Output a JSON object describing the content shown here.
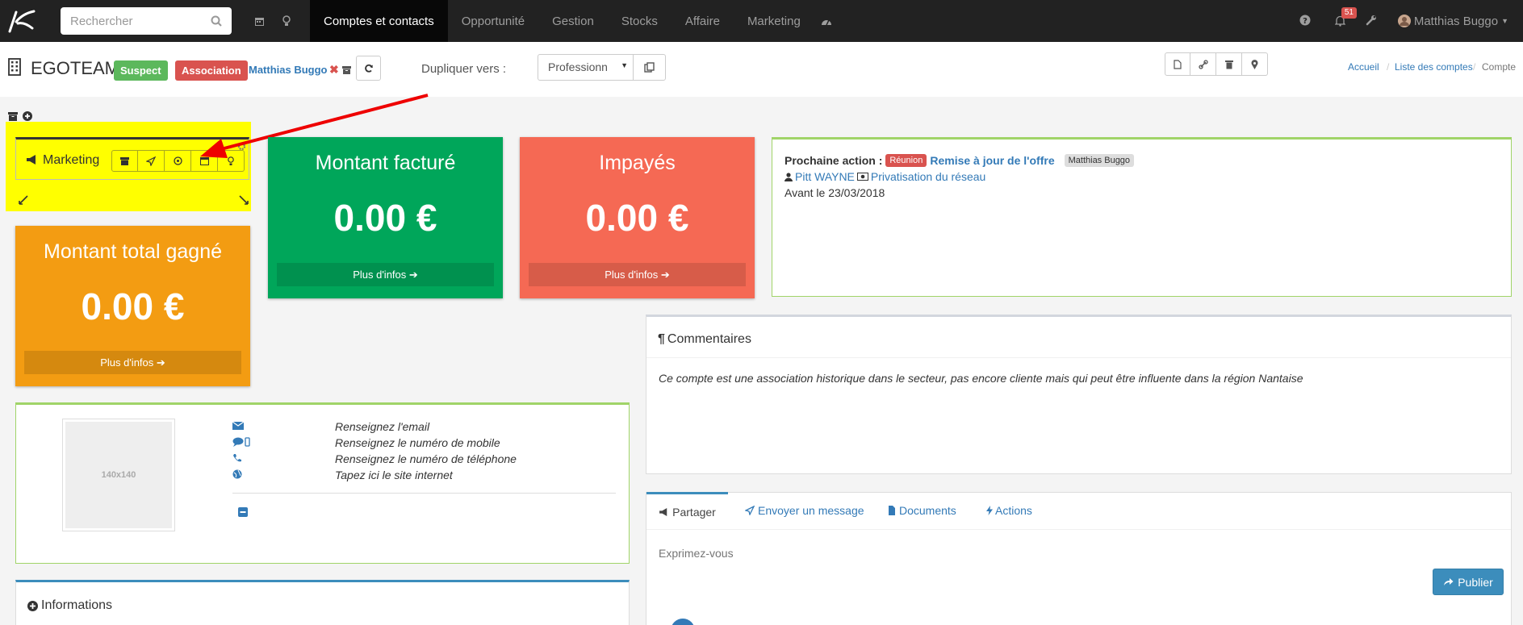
{
  "nav": {
    "search_placeholder": "Rechercher",
    "items": [
      "Comptes et contacts",
      "Opportunité",
      "Gestion",
      "Stocks",
      "Affaire",
      "Marketing"
    ],
    "notifications_count": "51",
    "user_name": "Matthias Buggo"
  },
  "header": {
    "title": "EGOTEAM",
    "status_badge": "Suspect",
    "type_badge": "Association",
    "owner": "Matthias Buggo",
    "duplicate_label": "Dupliquer vers :",
    "duplicate_select_value": "Professionn",
    "breadcrumb": [
      "Accueil",
      "Liste des comptes",
      "Compte"
    ]
  },
  "marketing_widget": {
    "label": "Marketing"
  },
  "boxes": {
    "billed": {
      "title": "Montant facturé",
      "value": "0.00 €",
      "more": "Plus d'infos",
      "color": "#00a65a"
    },
    "unpaid": {
      "title": "Impayés",
      "value": "0.00 €",
      "more": "Plus d'infos",
      "color": "#f56954"
    },
    "won": {
      "title": "Montant total gagné",
      "value": "0.00 €",
      "more": "Plus d'infos",
      "color": "#f39c12"
    }
  },
  "next_action": {
    "label": "Prochaine action :",
    "tag": "Réunion",
    "title": "Remise à jour de l'offre",
    "user_tag": "Matthias Buggo",
    "contact": "Pitt WAYNE",
    "project": "Privatisation du réseau",
    "deadline": "Avant le 23/03/2018"
  },
  "comments": {
    "title": "Commentaires",
    "text": "Ce compte est une association historique dans le secteur, pas encore cliente mais qui peut être influente dans la région Nantaise"
  },
  "contact": {
    "placeholder_img": "140x140",
    "email": "Renseignez l'email",
    "mobile": "Renseignez le numéro de mobile",
    "phone": "Renseignez le numéro de téléphone",
    "website": "Tapez ici le site internet"
  },
  "informations": {
    "title": "Informations"
  },
  "share": {
    "tabs": [
      "Partager",
      "Envoyer un message",
      "Documents",
      "Actions"
    ],
    "placeholder": "Exprimez-vous",
    "publish": "Publier"
  }
}
